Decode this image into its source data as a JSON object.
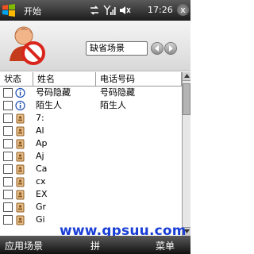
{
  "statusbar": {
    "start_label": "开始",
    "time": "17:26",
    "close_label": "x"
  },
  "header": {
    "profile": "缺省场景"
  },
  "table": {
    "headers": {
      "status": "状态",
      "name": "姓名",
      "phone": "电话号码"
    },
    "rows": [
      {
        "icon": "info-icon",
        "name": "号码隐藏",
        "phone": "号码隐藏"
      },
      {
        "icon": "info-icon",
        "name": "陌生人",
        "phone": "陌生人"
      },
      {
        "icon": "contact-icon",
        "name": "7:",
        "phone": ""
      },
      {
        "icon": "contact-icon",
        "name": "Al",
        "phone": ""
      },
      {
        "icon": "contact-icon",
        "name": "Ap",
        "phone": ""
      },
      {
        "icon": "contact-icon",
        "name": "Aj",
        "phone": ""
      },
      {
        "icon": "contact-icon",
        "name": "Ca",
        "phone": ""
      },
      {
        "icon": "contact-icon",
        "name": "cx",
        "phone": ""
      },
      {
        "icon": "contact-icon",
        "name": "EX",
        "phone": ""
      },
      {
        "icon": "contact-icon",
        "name": "Gr",
        "phone": ""
      },
      {
        "icon": "contact-icon",
        "name": "Gi",
        "phone": ""
      }
    ]
  },
  "watermark": "www.gpsuu.com",
  "softkeys": {
    "left": "应用场景",
    "middle": "拼",
    "right": "菜单"
  }
}
